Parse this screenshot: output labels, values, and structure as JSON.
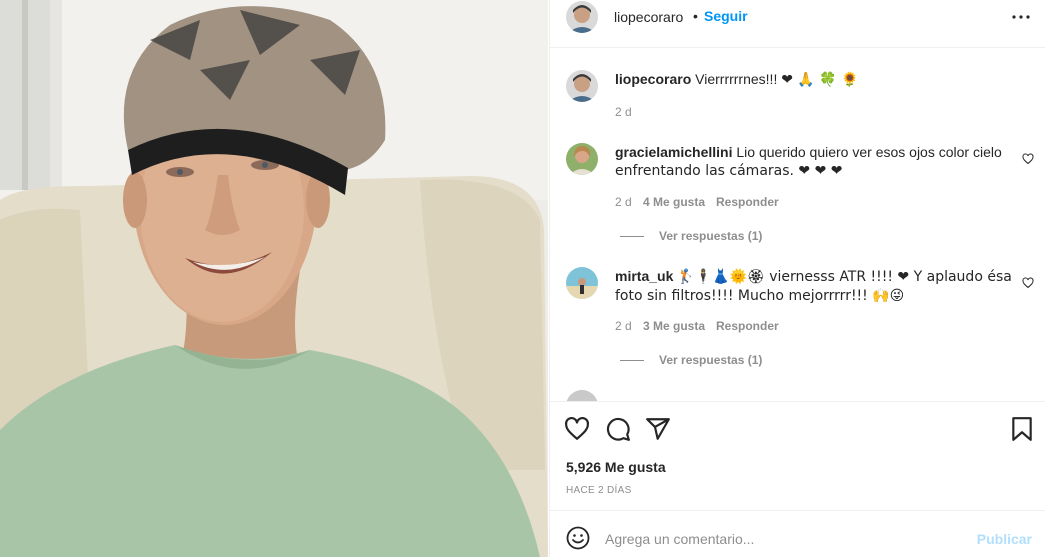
{
  "post": {
    "photo_alt": "",
    "author": {
      "username": "liopecoraro",
      "separator": "•",
      "follow_label": "Seguir",
      "more_icon": "more-horizontal-icon"
    },
    "caption": {
      "username": "liopecoraro",
      "text": "Vierrrrrrnes!!!",
      "emoji": "❤ 🙏 🍀 🌻",
      "time": "2 d"
    },
    "comments": [
      {
        "username": "gracielamichellini",
        "text_line1": "Lio querido quiero ver esos ojos color cielo",
        "text_line2": "enfrentando las cámaras. ❤ ❤ ❤",
        "time": "2 d",
        "likes": "4 Me gusta",
        "reply_label": "Responder",
        "view_replies": "Ver respuestas (1)"
      },
      {
        "username": "mirta_uk",
        "text_line1": "🏌🕴👗🌞🏵 viernesss ATR !!!! ❤ Y aplaudo ésa",
        "text_line2": "foto sin filtros!!!! Mucho mejorrrrr!!! 🙌😜",
        "time": "2 d",
        "likes": "3 Me gusta",
        "reply_label": "Responder",
        "view_replies": "Ver respuestas (1)"
      }
    ],
    "likes_count": "5,926 Me gusta",
    "posted_ago": "HACE 2 DÍAS",
    "add_comment_placeholder": "Agrega un comentario...",
    "publish_label": "Publicar"
  },
  "colors": {
    "link_blue": "#0095f6",
    "muted_text": "#8e8e8e",
    "publish_disabled": "#b2dffc",
    "heart_red": "#ed4956"
  }
}
